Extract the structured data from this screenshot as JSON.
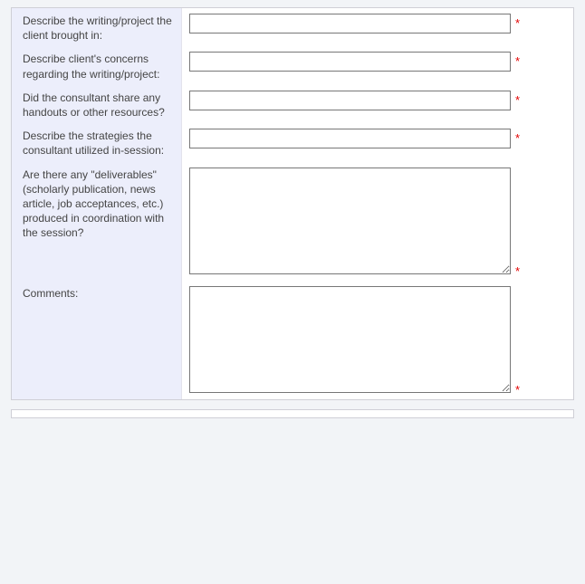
{
  "required_marker": "*",
  "fields": [
    {
      "key": "project_brought",
      "label": "Describe the writing/project the client brought in:",
      "type": "input",
      "required": true,
      "value": ""
    },
    {
      "key": "client_concerns",
      "label": "Describe client's concerns regarding the writing/project:",
      "type": "input",
      "required": true,
      "value": ""
    },
    {
      "key": "handouts_shared",
      "label": "Did the consultant share any handouts or other resources?",
      "type": "input",
      "required": true,
      "value": ""
    },
    {
      "key": "strategies",
      "label": "Describe the strategies the consultant utilized in-session:",
      "type": "input",
      "required": true,
      "value": ""
    },
    {
      "key": "deliverables",
      "label": "Are there any \"deliverables\" (scholarly publication, news article, job acceptances, etc.) produced in coordination with the session?",
      "type": "textarea",
      "required": true,
      "value": ""
    },
    {
      "key": "comments",
      "label": "Comments:",
      "type": "textarea",
      "required": true,
      "value": ""
    }
  ]
}
